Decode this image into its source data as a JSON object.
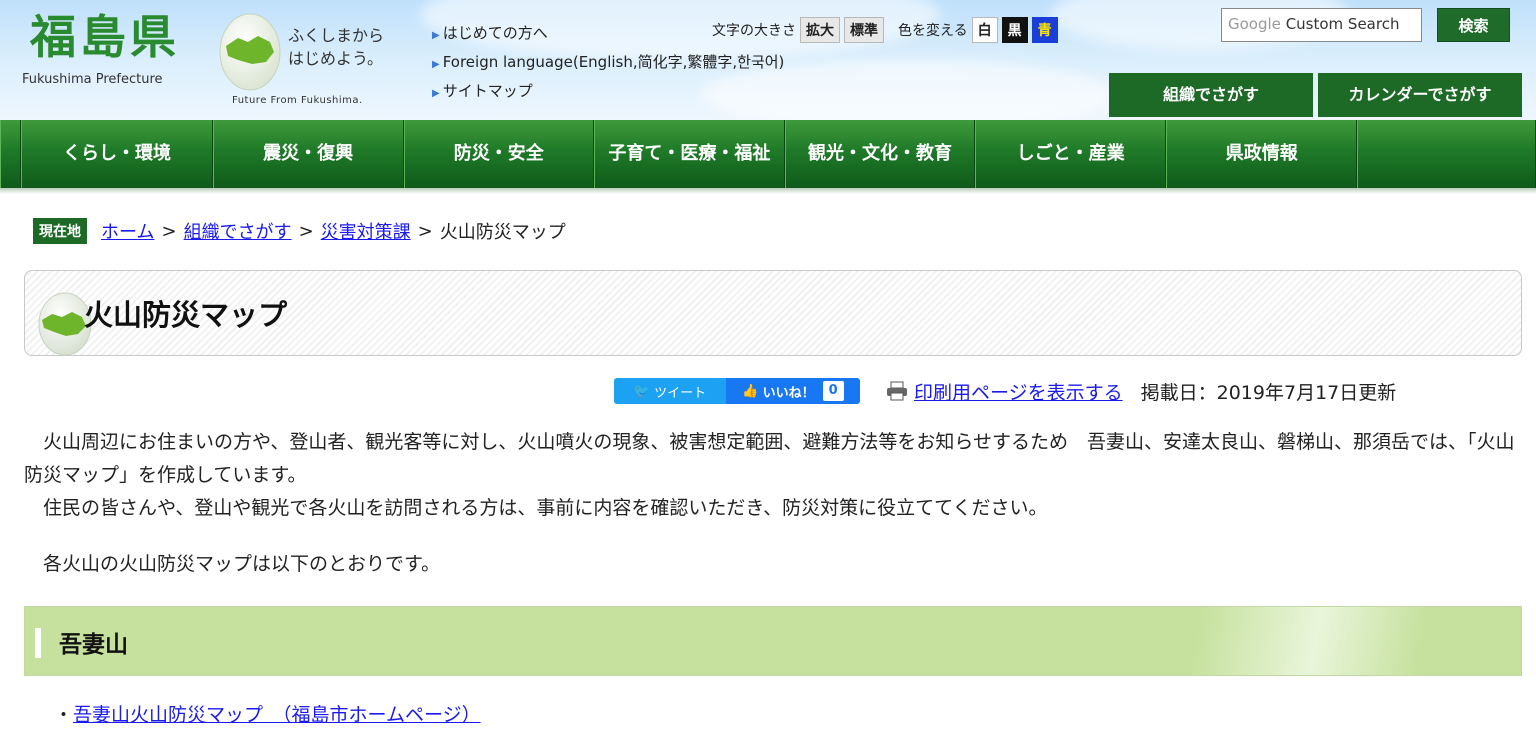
{
  "header": {
    "logo_kanji": "福島県",
    "logo_en": "Fukushima Prefecture",
    "tagline_line1": "ふくしまから",
    "tagline_line2": "はじめよう。",
    "tagline_en": "Future From Fukushima.",
    "links": [
      {
        "label": "はじめての方へ"
      },
      {
        "label": "Foreign language(English,简化字,繁體字,한국어)"
      },
      {
        "label": "サイトマップ"
      }
    ],
    "font_size_label": "文字の大きさ",
    "font_large": "拡大",
    "font_standard": "標準",
    "color_label": "色を変える",
    "color_white": "白",
    "color_black": "黒",
    "color_blue": "青",
    "search_google": "Google",
    "search_placeholder": "Custom Search",
    "search_button": "検索",
    "org_search": "組織でさがす",
    "calendar_search": "カレンダーでさがす"
  },
  "nav": [
    "くらし・環境",
    "震災・復興",
    "防災・安全",
    "子育て・医療・福祉",
    "観光・文化・教育",
    "しごと・産業",
    "県政情報"
  ],
  "breadcrumb": {
    "here": "現在地",
    "items": [
      "ホーム",
      "組織でさがす",
      "災害対策課"
    ],
    "current": "火山防災マップ"
  },
  "page": {
    "title": "火山防災マップ",
    "tweet": "ツイート",
    "like": "いいね！",
    "like_count": "0",
    "print_link": "印刷用ページを表示する",
    "posted": "掲載日：2019年7月17日更新",
    "para1": "　火山周辺にお住まいの方や、登山者、観光客等に対し、火山噴火の現象、被害想定範囲、避難方法等をお知らせするため　吾妻山、安達太良山、磐梯山、那須岳では、「火山防災マップ」を作成しています。",
    "para2": "　住民の皆さんや、登山や観光で各火山を訪問される方は、事前に内容を確認いただき、防災対策に役立ててください。",
    "para3": "　各火山の火山防災マップは以下のとおりです。",
    "section_heading": "吾妻山",
    "section_bullet": "・",
    "section_link": "吾妻山火山防災マップ　（福島市ホームページ）"
  },
  "colors": {
    "nav_green": "#1f7a28",
    "button_green": "#1d6a27",
    "link_blue": "#1a1aee",
    "section_green": "#c6e19e"
  }
}
